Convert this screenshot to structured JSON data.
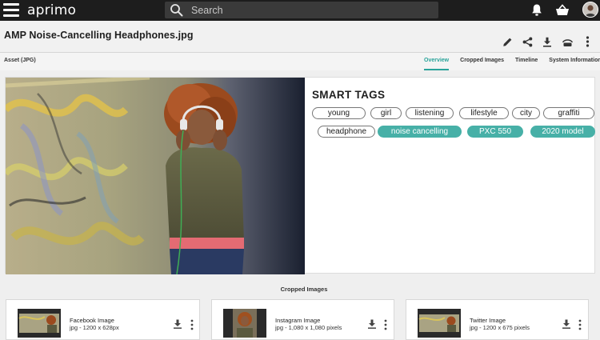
{
  "header": {
    "logo_text": "aprimo",
    "search_placeholder": "Search"
  },
  "asset": {
    "title": "AMP Noise-Cancelling Headphones.jpg",
    "type_label": "Asset (JPG)"
  },
  "tabs": [
    {
      "label": "Overview",
      "active": true
    },
    {
      "label": "Cropped Images",
      "active": false
    },
    {
      "label": "Timeline",
      "active": false
    },
    {
      "label": "System Information",
      "active": false
    }
  ],
  "smart_tags": {
    "title": "SMART TAGS",
    "row1": [
      {
        "label": "young",
        "highlighted": false
      },
      {
        "label": "girl",
        "highlighted": false
      },
      {
        "label": "listening",
        "highlighted": false
      },
      {
        "label": "lifestyle",
        "highlighted": false
      },
      {
        "label": "city",
        "highlighted": false
      },
      {
        "label": "graffiti",
        "highlighted": false
      }
    ],
    "row2": [
      {
        "label": "headphone",
        "highlighted": false
      },
      {
        "label": "noise cancelling",
        "highlighted": true
      },
      {
        "label": "PXC 550",
        "highlighted": true
      },
      {
        "label": "2020 model",
        "highlighted": true
      }
    ]
  },
  "cropped": {
    "section_label": "Cropped Images",
    "items": [
      {
        "name": "Facebook Image",
        "desc": "jpg - 1200 x 628px"
      },
      {
        "name": "Instagram Image",
        "desc": "jpg - 1,080 x 1,080 pixels"
      },
      {
        "name": "Twitter Image",
        "desc": "jpg - 1200 x 675 pixels"
      }
    ]
  },
  "colors": {
    "accent": "#47b0a7",
    "topbar": "#1d1d1d",
    "logo_dot": "#2db4c8"
  },
  "icons": [
    "menu-icon",
    "search-icon",
    "bell-icon",
    "basket-icon",
    "user-avatar",
    "pencil-icon",
    "share-icon",
    "download-icon",
    "fingerprint-icon",
    "more-vertical-icon"
  ]
}
